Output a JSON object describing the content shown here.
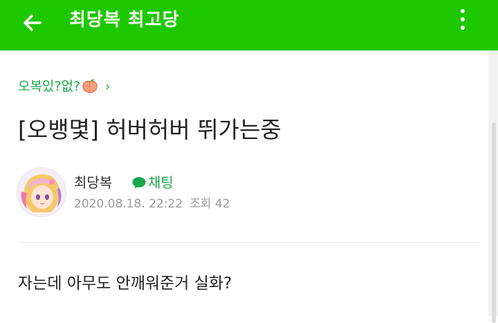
{
  "appbar": {
    "title": "최당복 최고당",
    "color": "#1ec800",
    "back_icon": "arrow-left-icon",
    "more_icon": "vertical-dots-icon"
  },
  "board": {
    "label": "오복있?없?",
    "emoji": "peach-icon",
    "chevron": "›",
    "color": "#1aa64a"
  },
  "post": {
    "title": "[오뱅몇] 허버허버 뛰가는중",
    "author": "최당복",
    "chat_label": "채팅",
    "chat_icon": "chat-bubble-icon",
    "date": "2020.08.18. 22:22",
    "views_label": "조회 42",
    "body": "자는데 아무도 안깨워준거 실화?"
  }
}
